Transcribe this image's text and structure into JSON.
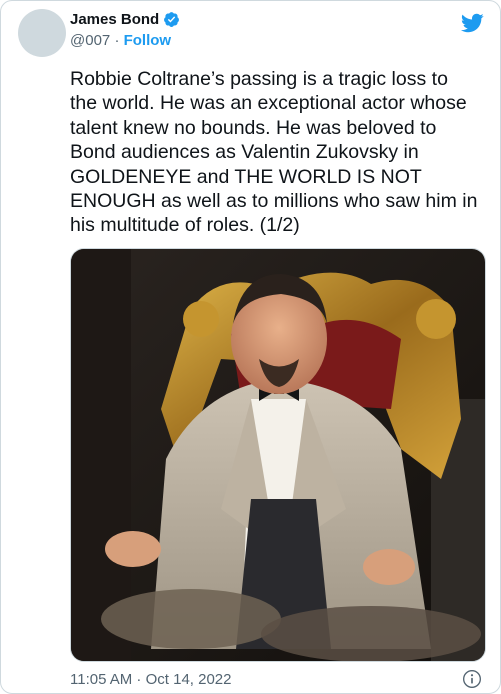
{
  "author": {
    "display_name": "James Bond",
    "handle": "@007",
    "separator": "·",
    "follow_label": "Follow",
    "verified": true
  },
  "tweet": {
    "text": "Robbie Coltrane’s passing is a tragic loss to\nthe world. He was an exceptional actor whose\ntalent knew no bounds. He was beloved to\nBond audiences as Valentin Zukovsky in\nGOLDENEYE and THE WORLD IS NOT\nENOUGH as well as to millions who saw him in\nhis multitude of roles. (1/2)",
    "timestamp": "11:05 AM · Oct 14, 2022"
  },
  "icons": {
    "brand": "twitter-bird-icon",
    "verified": "verified-badge-icon",
    "info": "info-icon"
  },
  "colors": {
    "accent": "#1d9bf0",
    "text_primary": "#0f1419",
    "text_secondary": "#536471",
    "border": "#cfd9de"
  }
}
